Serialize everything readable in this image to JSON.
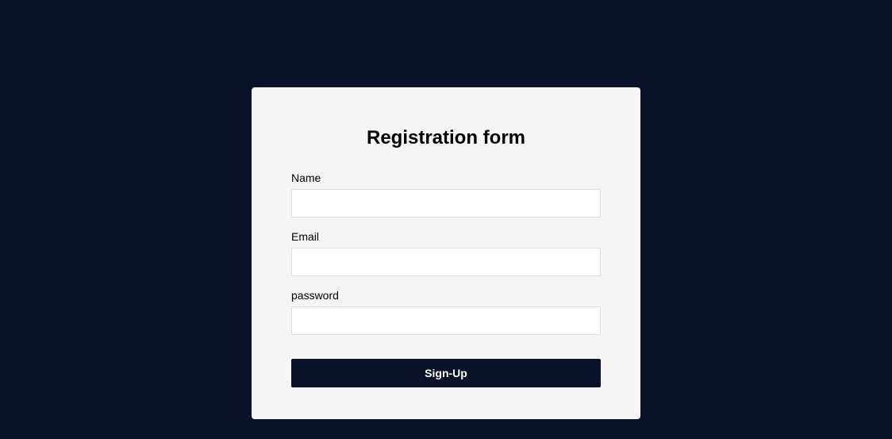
{
  "form": {
    "title": "Registration form",
    "fields": {
      "name": {
        "label": "Name",
        "value": ""
      },
      "email": {
        "label": "Email",
        "value": ""
      },
      "password": {
        "label": "password",
        "value": ""
      }
    },
    "submit_label": "Sign-Up"
  }
}
